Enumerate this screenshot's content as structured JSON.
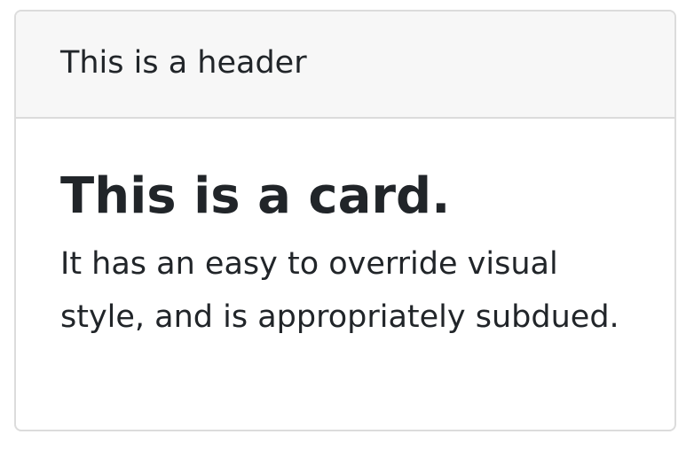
{
  "card": {
    "header": "This is a header",
    "title": "This is a card.",
    "text": "It has an easy to override visual style, and is appropriately subdued."
  },
  "colors": {
    "header_background": "#f7f7f7",
    "border": "#dcdcdc",
    "text": "#212529",
    "background": "#ffffff"
  }
}
